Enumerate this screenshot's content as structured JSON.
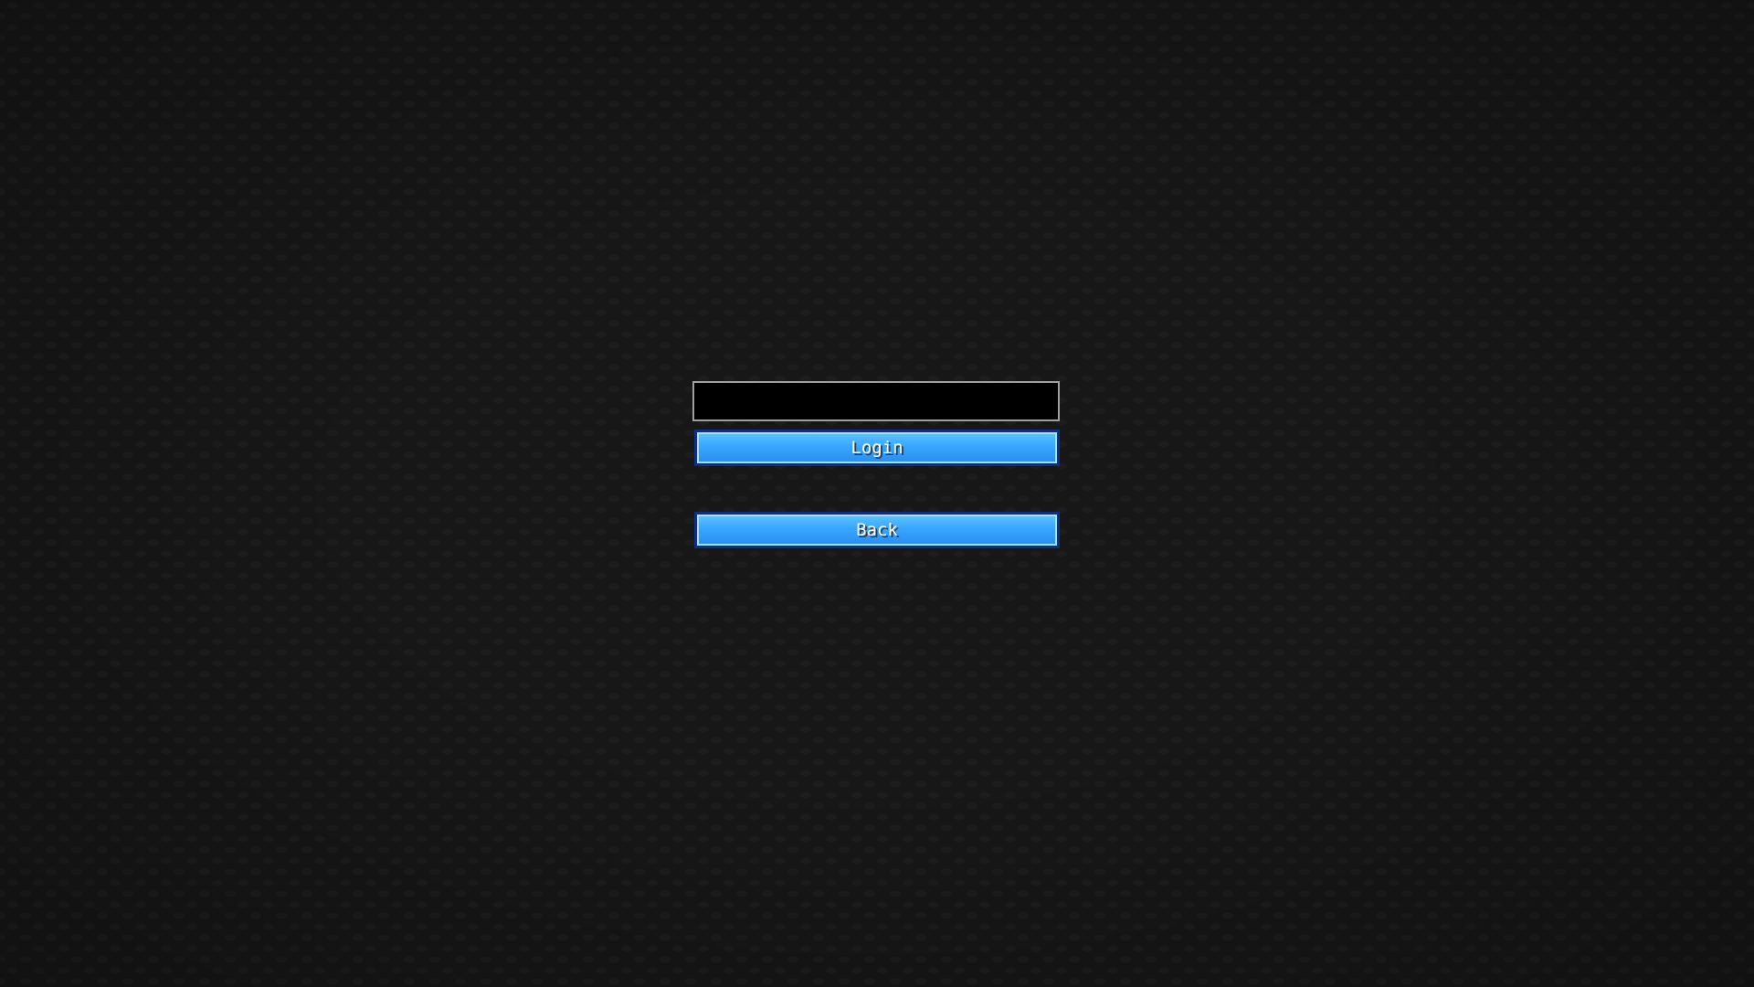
{
  "login_form": {
    "input_value": "",
    "input_placeholder": "",
    "login_label": "Login",
    "back_label": "Back"
  },
  "colors": {
    "background": "#171717",
    "button_fill": "#38a6ff",
    "button_border": "#0d2f8a",
    "input_fill": "#000000",
    "input_border": "#a0a0a0"
  }
}
